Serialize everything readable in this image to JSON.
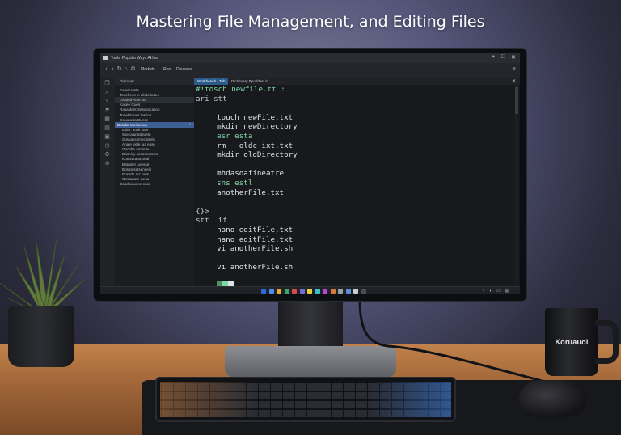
{
  "headline": "Mastering File Management, and Editing Files",
  "mug_text": "Koruauol",
  "ide": {
    "window_controls": [
      "+",
      "□",
      "✕"
    ],
    "menu": [
      "Tools",
      "Popular",
      "Ways Ar",
      "Has"
    ],
    "toolbar_buttons": [
      "Markets",
      "Run",
      "Devases"
    ],
    "tabs": [
      "Workbench · Tab",
      "Dictionary Bpod/test.it"
    ],
    "explorer_header": "Discover",
    "explorer_items": [
      {
        "label": "Earwit tests",
        "state": "normal",
        "indent": 1
      },
      {
        "label": "Toucheus in alicto kutes",
        "state": "normal",
        "indent": 1
      },
      {
        "label": "Leaded Auer act",
        "state": "highlight",
        "indent": 1
      },
      {
        "label": "Kasee Gues",
        "state": "normal",
        "indent": 1
      },
      {
        "label": "Rasasterk Sesusocation",
        "state": "normal",
        "indent": 1
      },
      {
        "label": "Tonelstones testion",
        "state": "normal",
        "indent": 1
      },
      {
        "label": "Gouatasla Bunce",
        "state": "normal",
        "indent": 1
      },
      {
        "label": "Deadat Merca.avy",
        "state": "selected",
        "indent": 0
      },
      {
        "label": "Eslar: sosk stes",
        "state": "normal",
        "indent": 2
      },
      {
        "label": "Ssecalarlatetuete",
        "state": "normal",
        "indent": 2
      },
      {
        "label": "Sosuaecsmecatsels",
        "state": "normal",
        "indent": 2
      },
      {
        "label": "Anale viele lua euse",
        "state": "normal",
        "indent": 2
      },
      {
        "label": "Gocalte ancenau",
        "state": "normal",
        "indent": 2
      },
      {
        "label": "Dasnisy ascosecsees",
        "state": "normal",
        "indent": 2
      },
      {
        "label": "Kotavata anoeal",
        "state": "normal",
        "indent": 2
      },
      {
        "label": "Bataleel Lwesse",
        "state": "normal",
        "indent": 2
      },
      {
        "label": "Bosatosetsensels",
        "state": "normal",
        "indent": 2
      },
      {
        "label": "Eosetts arc nats",
        "state": "normal",
        "indent": 2
      },
      {
        "label": "Gestaaate wesa",
        "state": "normal",
        "indent": 2
      },
      {
        "label": "Dasdoa uoee cuas",
        "state": "normal",
        "indent": 1
      }
    ],
    "code_lines": [
      {
        "text": "#!tosch newfile.tt :",
        "col": 0,
        "style": "g"
      },
      {
        "text": "ari stt",
        "col": 0,
        "style": "dim"
      },
      {
        "text": "",
        "col": 0,
        "style": "dim"
      },
      {
        "text": "touch newFile.txt",
        "col": 3,
        "style": ""
      },
      {
        "text": "mkdir newDirectory",
        "col": 3,
        "style": ""
      },
      {
        "text": "esr esta",
        "col": 3,
        "style": "g"
      },
      {
        "text": "rm   oldc ixt.txt",
        "col": 3,
        "style": ""
      },
      {
        "text": "mkdir oldDirectory",
        "col": 3,
        "style": ""
      },
      {
        "text": "",
        "col": 0,
        "style": ""
      },
      {
        "text": "mhdasoafineatre",
        "col": 3,
        "style": ""
      },
      {
        "text": "sns estl",
        "col": 3,
        "style": "g"
      },
      {
        "text": "anotherFile.txt",
        "col": 3,
        "style": ""
      },
      {
        "text": "",
        "col": 0,
        "style": ""
      },
      {
        "text": "{}>",
        "col": 0,
        "style": "dim"
      },
      {
        "text": "stt  if",
        "col": 0,
        "style": "dim"
      },
      {
        "text": "nano editFile.txt",
        "col": 3,
        "style": ""
      },
      {
        "text": "nano editFile.txt",
        "col": 3,
        "style": ""
      },
      {
        "text": "vi anotherFile.sh",
        "col": 3,
        "style": ""
      },
      {
        "text": "",
        "col": 0,
        "style": ""
      },
      {
        "text": "vi anotherFile.sh",
        "col": 3,
        "style": ""
      }
    ],
    "cursor_colors": [
      "#4f8f63",
      "#7fd6a6",
      "#dfe3e8"
    ],
    "activity_icons": [
      "files-icon",
      "search-icon",
      "git-icon",
      "debug-icon",
      "extensions-icon",
      "grid-icon",
      "terminal-icon",
      "clock-icon",
      "settings-icon",
      "zoom-icon"
    ],
    "taskbar_colors": [
      "#2b6cd6",
      "#4a8fe8",
      "#e6a93a",
      "#3aa86b",
      "#d64a4a",
      "#6b6fd6",
      "#e6cf3a",
      "#3ac2c2",
      "#b04ad6",
      "#d67a3a",
      "#9aa0a8",
      "#5a8fd6",
      "#c9ccd2",
      "#4a4d55"
    ]
  }
}
